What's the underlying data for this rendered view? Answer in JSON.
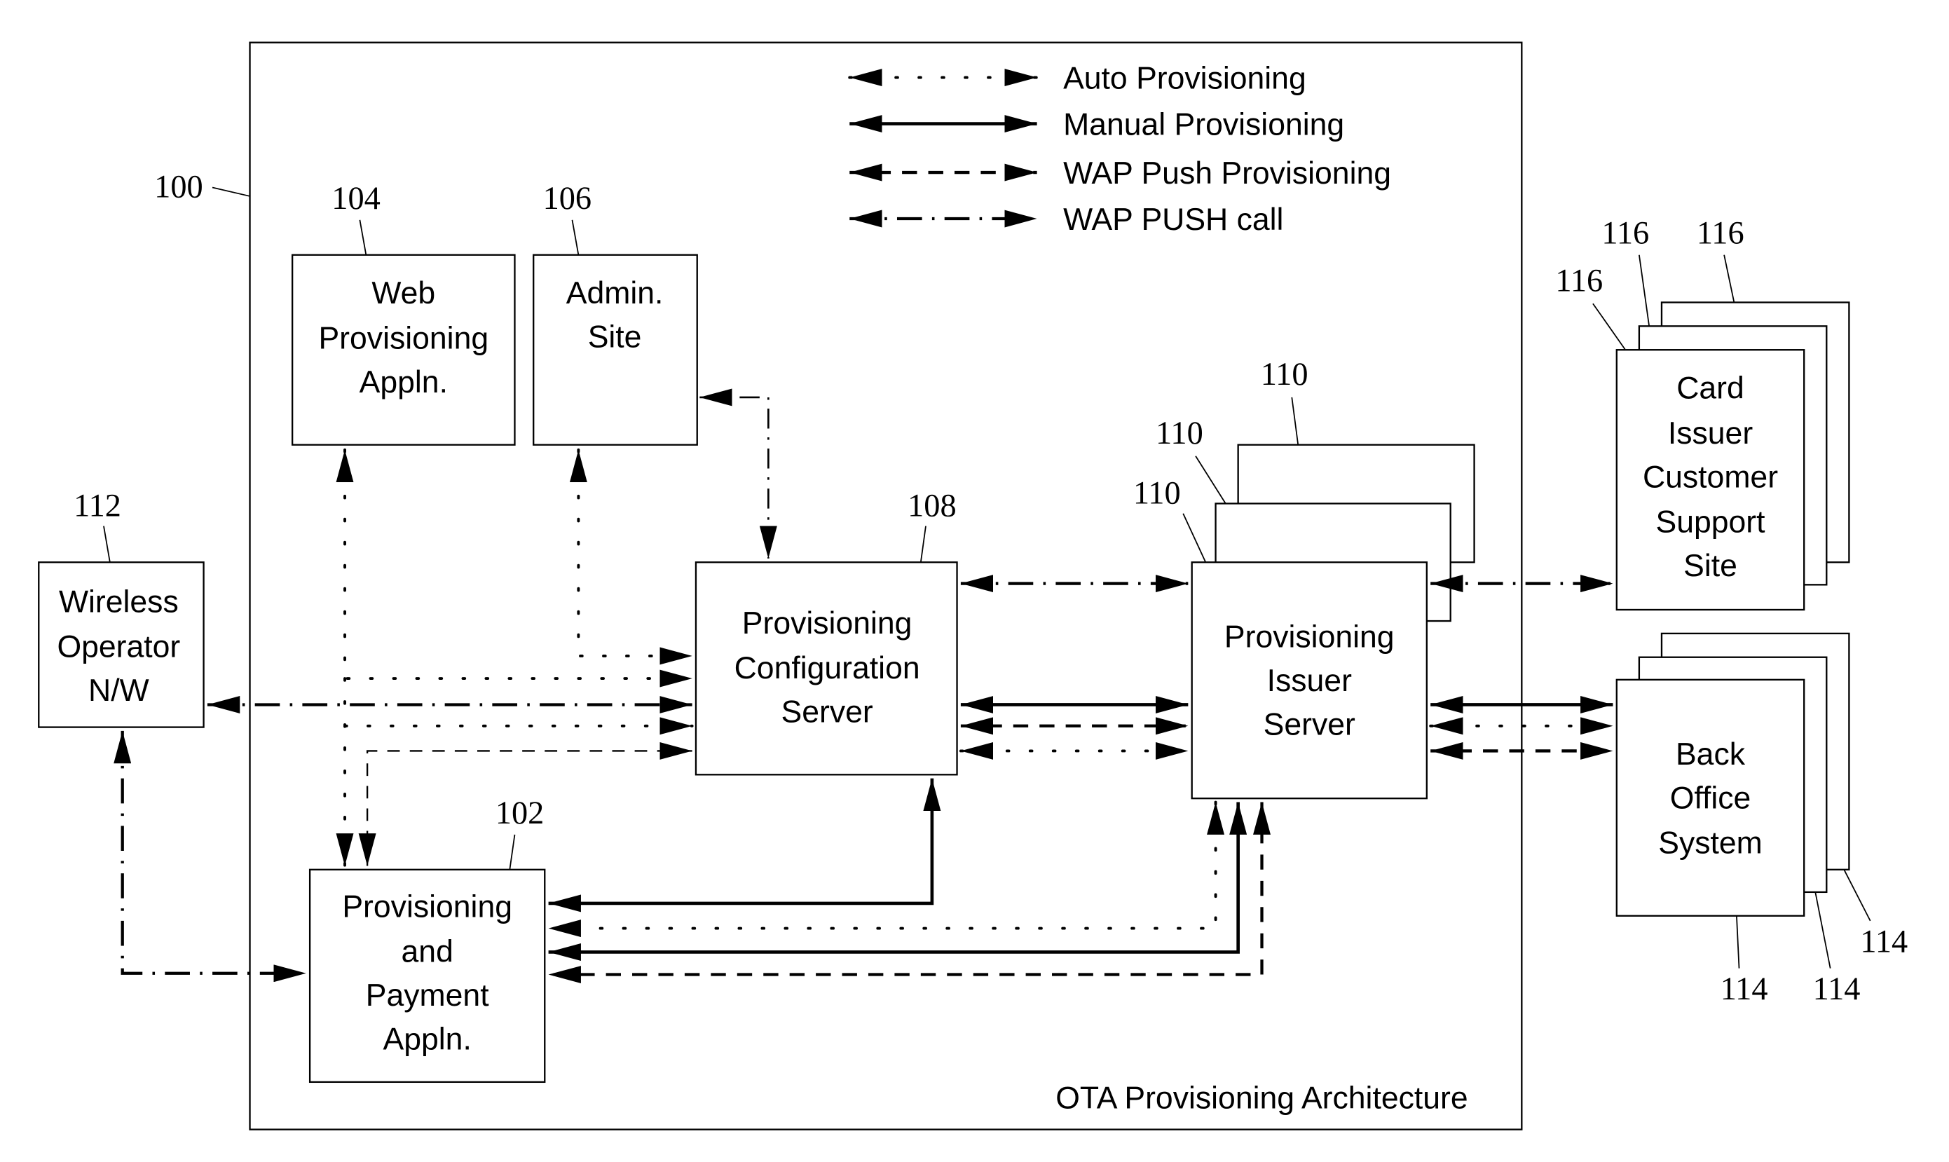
{
  "title": "OTA Provisioning Architecture",
  "system_ref": "100",
  "legend": [
    {
      "style": "dotted",
      "label": "Auto Provisioning"
    },
    {
      "style": "solid",
      "label": "Manual Provisioning"
    },
    {
      "style": "dashed",
      "label": "WAP Push Provisioning"
    },
    {
      "style": "dash-dot",
      "label": "WAP PUSH call"
    }
  ],
  "nodes": {
    "web_prov": {
      "ref": "104",
      "lines": [
        "Web",
        "Provisioning",
        "Appln."
      ]
    },
    "admin": {
      "ref": "106",
      "lines": [
        "Admin.",
        "Site"
      ]
    },
    "wireless": {
      "ref": "112",
      "lines": [
        "Wireless",
        "Operator",
        "N/W"
      ]
    },
    "config_server": {
      "ref": "108",
      "lines": [
        "Provisioning",
        "Configuration",
        "Server"
      ]
    },
    "issuer_server": {
      "ref": "110",
      "refs": [
        "110",
        "110",
        "110"
      ],
      "lines": [
        "Provisioning",
        "Issuer",
        "Server"
      ]
    },
    "prov_payment": {
      "ref": "102",
      "lines": [
        "Provisioning",
        "and",
        "Payment",
        "Appln."
      ]
    },
    "card_issuer": {
      "refs": [
        "116",
        "116",
        "116"
      ],
      "lines": [
        "Card",
        "Issuer",
        "Customer",
        "Support",
        "Site"
      ]
    },
    "back_office": {
      "refs": [
        "114",
        "114",
        "114"
      ],
      "lines": [
        "Back",
        "Office",
        "System"
      ]
    }
  },
  "connections": [
    {
      "from": "admin",
      "to": "config_server",
      "type": "WAP PUSH call"
    },
    {
      "from": "web_prov",
      "to": "config_server",
      "type": "Auto Provisioning"
    },
    {
      "from": "admin",
      "to": "config_server",
      "type": "Auto Provisioning"
    },
    {
      "from": "wireless",
      "to": "config_server",
      "type": "WAP PUSH call"
    },
    {
      "from": "prov_payment",
      "to": "config_server",
      "type": "Auto Provisioning"
    },
    {
      "from": "prov_payment",
      "to": "config_server",
      "type": "WAP Push Provisioning"
    },
    {
      "from": "wireless",
      "to": "prov_payment",
      "type": "WAP PUSH call"
    },
    {
      "from": "config_server",
      "to": "issuer_server",
      "type": "WAP PUSH call"
    },
    {
      "from": "config_server",
      "to": "issuer_server",
      "type": "Manual Provisioning"
    },
    {
      "from": "config_server",
      "to": "issuer_server",
      "type": "WAP Push Provisioning"
    },
    {
      "from": "config_server",
      "to": "issuer_server",
      "type": "Auto Provisioning"
    },
    {
      "from": "issuer_server",
      "to": "card_issuer",
      "type": "WAP PUSH call"
    },
    {
      "from": "issuer_server",
      "to": "back_office",
      "type": "Manual Provisioning"
    },
    {
      "from": "issuer_server",
      "to": "back_office",
      "type": "Auto Provisioning"
    },
    {
      "from": "issuer_server",
      "to": "back_office",
      "type": "WAP Push Provisioning"
    },
    {
      "from": "config_server",
      "to": "prov_payment",
      "type": "Manual Provisioning"
    },
    {
      "from": "issuer_server",
      "to": "prov_payment",
      "type": "Auto Provisioning"
    },
    {
      "from": "issuer_server",
      "to": "prov_payment",
      "type": "Manual Provisioning"
    },
    {
      "from": "issuer_server",
      "to": "prov_payment",
      "type": "WAP Push Provisioning"
    }
  ]
}
